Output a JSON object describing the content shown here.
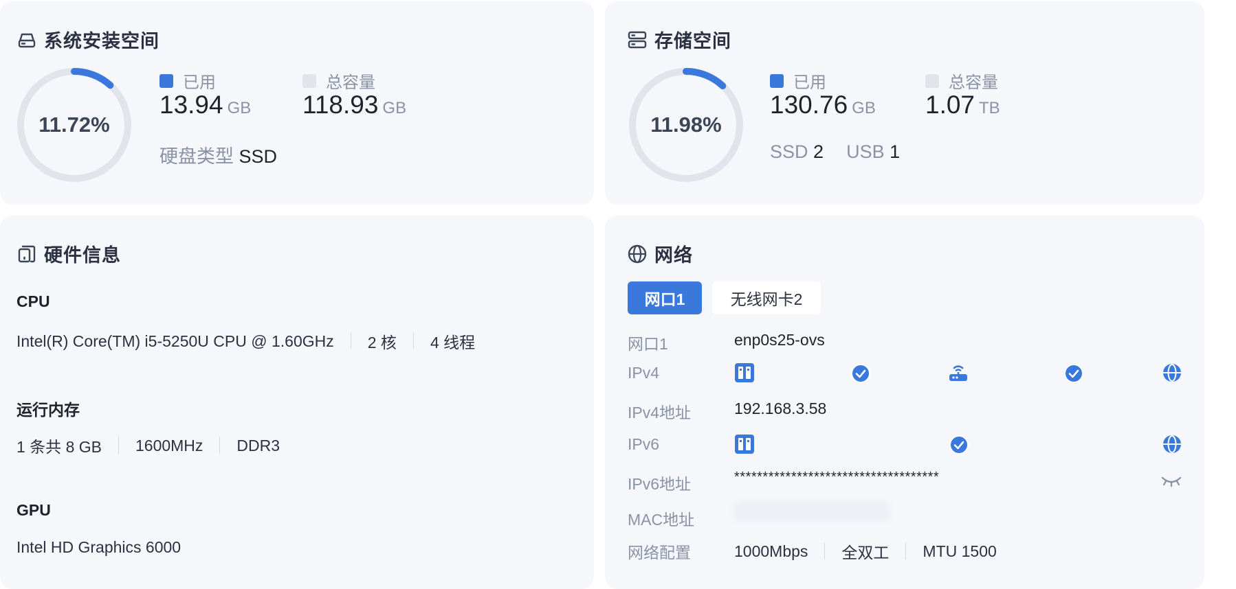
{
  "system_space": {
    "title": "系统安装空间",
    "used_percent": 11.72,
    "percent_text": "11.72%",
    "legend_used": "已用",
    "legend_total": "总容量",
    "used_value": "13.94",
    "used_unit": "GB",
    "total_value": "118.93",
    "total_unit": "GB",
    "disk_type_label": "硬盘类型",
    "disk_type_value": "SSD"
  },
  "storage_space": {
    "title": "存储空间",
    "used_percent": 11.98,
    "percent_text": "11.98%",
    "legend_used": "已用",
    "legend_total": "总容量",
    "used_value": "130.76",
    "used_unit": "GB",
    "total_value": "1.07",
    "total_unit": "TB",
    "ssd_label": "SSD",
    "ssd_count": "2",
    "usb_label": "USB",
    "usb_count": "1"
  },
  "hardware": {
    "title": "硬件信息",
    "cpu_heading": "CPU",
    "cpu_model": "Intel(R) Core(TM) i5-5250U CPU @ 1.60GHz",
    "cpu_cores": "2 核",
    "cpu_threads": "4 线程",
    "memory_heading": "运行内存",
    "memory_sticks": "1 条共 8 GB",
    "memory_speed": "1600MHz",
    "memory_type": "DDR3",
    "gpu_heading": "GPU",
    "gpu_model": "Intel HD Graphics 6000"
  },
  "network": {
    "title": "网络",
    "tabs": [
      {
        "label": "网口1",
        "active": true
      },
      {
        "label": "无线网卡2",
        "active": false
      }
    ],
    "port_label": "网口1",
    "port_value": "enp0s25-ovs",
    "ipv4_label": "IPv4",
    "ipv4_addr_label": "IPv4地址",
    "ipv4_addr_value": "192.168.3.58",
    "ipv6_label": "IPv6",
    "ipv6_addr_label": "IPv6地址",
    "ipv6_addr_value": "************************************",
    "mac_label": "MAC地址",
    "config_label": "网络配置",
    "speed": "1000Mbps",
    "duplex": "全双工",
    "mtu": "MTU 1500"
  },
  "colors": {
    "accent": "#3a78dc",
    "ring_track": "#e1e4ea",
    "card_bg": "#f5f7fb",
    "muted_text": "#8a93a6"
  },
  "icons": [
    "hard-drive-icon",
    "server-icon",
    "device-icon",
    "globe-icon",
    "nas-icon",
    "router-icon",
    "check-icon",
    "eye-closed-icon"
  ]
}
